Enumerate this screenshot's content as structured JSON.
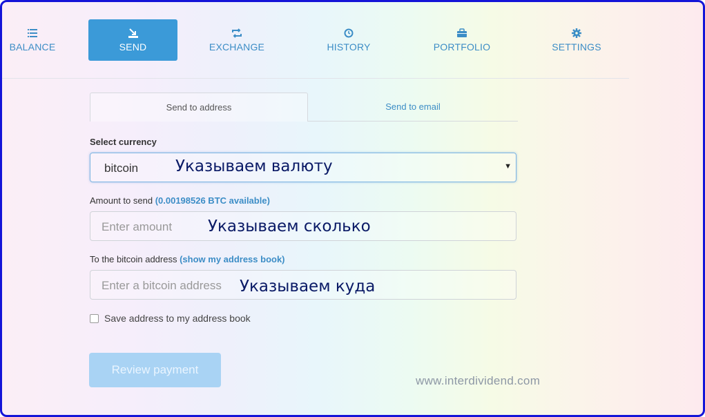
{
  "nav": {
    "items": [
      {
        "label": "BALANCE",
        "icon": "list-icon"
      },
      {
        "label": "SEND",
        "icon": "send-icon"
      },
      {
        "label": "EXCHANGE",
        "icon": "exchange-icon"
      },
      {
        "label": "HISTORY",
        "icon": "clock-icon"
      },
      {
        "label": "PORTFOLIO",
        "icon": "briefcase-icon"
      },
      {
        "label": "SETTINGS",
        "icon": "gear-icon"
      }
    ],
    "active": "SEND"
  },
  "tabs": {
    "send_to_address": "Send to address",
    "send_to_email": "Send to email"
  },
  "form": {
    "currency_label": "Select currency",
    "currency_value": "bitcoin",
    "currency_note": "Указываем валюту",
    "amount_label": "Amount to send",
    "amount_available": "(0.00198526 BTC available)",
    "amount_placeholder": "Enter amount",
    "amount_note": "Указываем сколько",
    "address_label": "To the bitcoin address",
    "address_book_link": "(show my address book)",
    "address_placeholder": "Enter a bitcoin address",
    "address_note": "Указываем куда",
    "save_checkbox_label": "Save address to my address book",
    "review_button": "Review payment"
  },
  "watermark": "www.interdividend.com",
  "colors": {
    "accent": "#3b9ad8",
    "link": "#3c8dc6",
    "frame": "#1414d8",
    "button_disabled": "#a9d3f4"
  }
}
